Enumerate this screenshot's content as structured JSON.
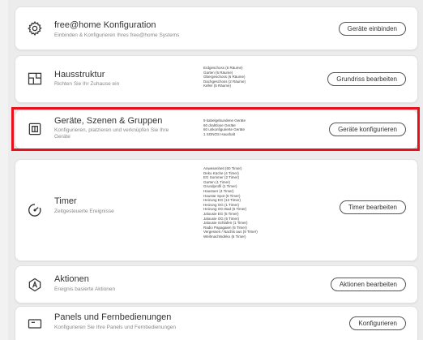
{
  "cards": [
    {
      "title": "free@home Konfiguration",
      "subtitle": "Einbinden & Konfigurieren Ihres free@home Systems",
      "button": "Geräte einbinden",
      "icon": "gear-icon",
      "details": []
    },
    {
      "title": "Hausstruktur",
      "subtitle": "Richten Sie Ihr Zuhause ein",
      "button": "Grundriss bearbeiten",
      "icon": "floorplan-icon",
      "details": [
        "Erdgeschoss (6 Räume)",
        "Garten (5 Räume)",
        "Obergeschoss (6 Räume)",
        "Dachgeschoss (2 Räume)",
        "Keller (5 Räume)"
      ]
    },
    {
      "title": "Geräte, Szenen & Gruppen",
      "subtitle": "Konfigurieren, platzieren und verknüpfen Sie Ihre Geräte",
      "button": "Geräte konfigurieren",
      "icon": "device-icon",
      "details": [
        "9 kabelgebundene Geräte",
        "60 drahtlose Geräte",
        "60 unkonfigurierte Geräte",
        "1 SONOS Haushalt"
      ]
    },
    {
      "title": "Timer",
      "subtitle": "Zeitgesteuerte Ereignisse",
      "button": "Timer bearbeiten",
      "icon": "timer-icon",
      "details": [
        "Anwesenheit (60 Timer)",
        "Deko Küche (4 Timer)",
        "EG Sommer (2 Timer)",
        "Garten (1 Timer)",
        "Grundprofil (1 Timer)",
        "Haustuer (4 Timer)",
        "Haustür Spot (6 Timer)",
        "Heizung EG (13 Timer)",
        "Heizung OG (1 Timer)",
        "Heizung OG Bad (6 Timer)",
        "Jalousie EG (5 Timer)",
        "Jalousie OG (6 Timer)",
        "Jalousie Schlafen (1 Timer)",
        "Radio Papagaien (5 Timer)",
        "Vergessen / Nachts aus (9 Timer)",
        "Weihnachtsdeko (6 Timer)"
      ]
    },
    {
      "title": "Aktionen",
      "subtitle": "Ereignis basierte Aktionen",
      "button": "Aktionen bearbeiten",
      "icon": "action-icon",
      "details": []
    },
    {
      "title": "Panels und Fernbedienungen",
      "subtitle": "Konfigurieren Sie Ihre Panels und Fernbedienungen",
      "button": "Konfigurieren",
      "icon": "panel-icon",
      "details": []
    }
  ],
  "highlight_color": "#e8101a"
}
